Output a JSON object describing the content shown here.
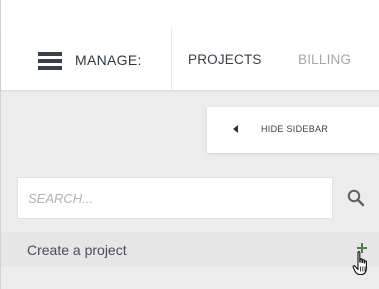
{
  "nav": {
    "manage_label": "MANAGE:",
    "tabs": [
      {
        "label": "PROJECTS",
        "active": true
      },
      {
        "label": "BILLING",
        "active": false
      }
    ]
  },
  "sidebar_toggle": {
    "label": "HIDE SIDEBAR",
    "icon": "caret-left-icon"
  },
  "search": {
    "placeholder": "SEARCH...",
    "value": "",
    "icon": "search-icon"
  },
  "create_project": {
    "label": "Create a project",
    "icon": "plus-icon"
  },
  "colors": {
    "background": "#ececec",
    "nav_text": "#3a3d45",
    "inactive_tab": "#a3a5ab",
    "plus_icon": "#4f7d4a"
  }
}
